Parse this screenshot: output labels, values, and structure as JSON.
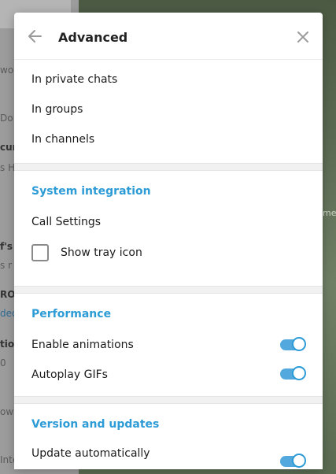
{
  "background": {
    "left_fragments": [
      "wor",
      "Do",
      "cur",
      "s H",
      "f's",
      "s r",
      "RO",
      "deo",
      "tion",
      "0",
      "ow",
      "Inte"
    ],
    "right_fragments": [
      "me"
    ]
  },
  "dialog": {
    "title": "Advanced",
    "back_icon": "arrow-left-icon",
    "close_icon": "close-icon"
  },
  "auto_download": {
    "items": [
      "In private chats",
      "In groups",
      "In channels"
    ]
  },
  "system_integration": {
    "title": "System integration",
    "call_settings": "Call Settings",
    "tray_label": "Show tray icon",
    "tray_checked": false
  },
  "performance": {
    "title": "Performance",
    "animations_label": "Enable animations",
    "animations_on": true,
    "gifs_label": "Autoplay GIFs",
    "gifs_on": true
  },
  "updates": {
    "title": "Version and updates",
    "auto_update_label": "Update automatically",
    "auto_update_on": true
  },
  "colors": {
    "accent": "#2c9bd6",
    "toggle_track": "#53a8dd",
    "divider": "#f1f1f1"
  }
}
